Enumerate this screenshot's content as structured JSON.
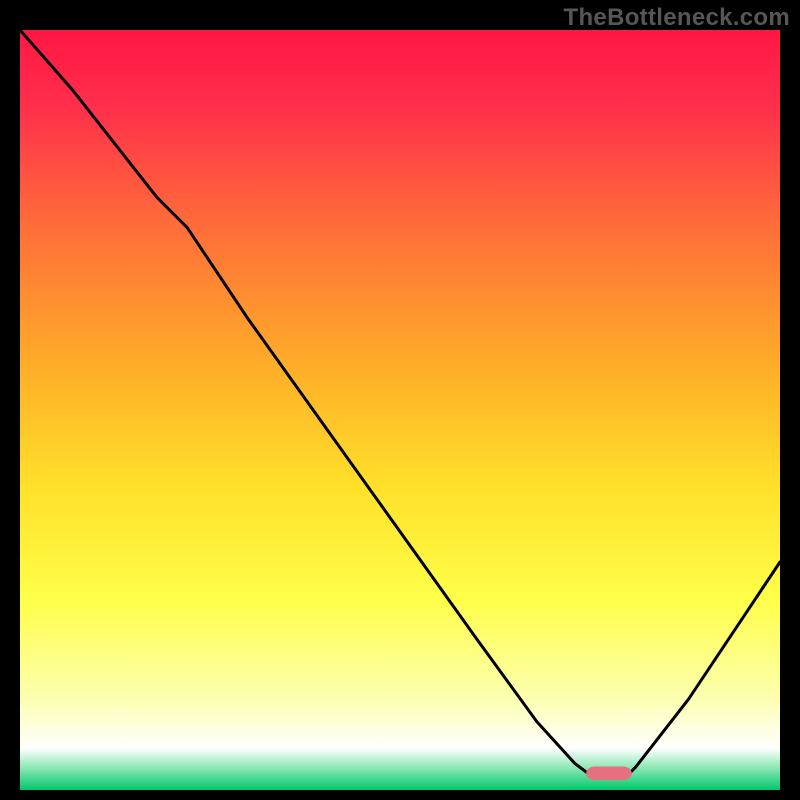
{
  "watermark": "TheBottleneck.com",
  "chart_data": {
    "type": "line",
    "title": "",
    "xlabel": "",
    "ylabel": "",
    "xlim": [
      0,
      100
    ],
    "ylim": [
      0,
      100
    ],
    "grid": false,
    "legend": false,
    "gradient": {
      "type": "vertical",
      "stops": [
        {
          "offset": 0.0,
          "color": "#ff1744"
        },
        {
          "offset": 0.1,
          "color": "#ff2f4b"
        },
        {
          "offset": 0.25,
          "color": "#ff6a3a"
        },
        {
          "offset": 0.45,
          "color": "#ffb028"
        },
        {
          "offset": 0.6,
          "color": "#ffe02a"
        },
        {
          "offset": 0.75,
          "color": "#ffff4a"
        },
        {
          "offset": 0.88,
          "color": "#fcffb0"
        },
        {
          "offset": 0.945,
          "color": "#ffffff"
        },
        {
          "offset": 0.97,
          "color": "#8fe8b6"
        },
        {
          "offset": 1.0,
          "color": "#00c86e"
        }
      ]
    },
    "series": [
      {
        "name": "bottleneck-curve",
        "color": "#000000",
        "width": 3,
        "x": [
          0,
          7,
          18,
          22,
          30,
          40,
          50,
          60,
          68,
          73,
          75,
          80,
          81,
          88,
          94,
          100
        ],
        "values": [
          100,
          92,
          78,
          74,
          62,
          48,
          34,
          20,
          9,
          3.5,
          2,
          2,
          3,
          12,
          21,
          30
        ]
      }
    ],
    "marker": {
      "name": "optimal-marker",
      "x": 77.5,
      "y": 2.2,
      "width": 6,
      "height": 1.8,
      "color": "#e67080",
      "radius": 1.2
    }
  }
}
